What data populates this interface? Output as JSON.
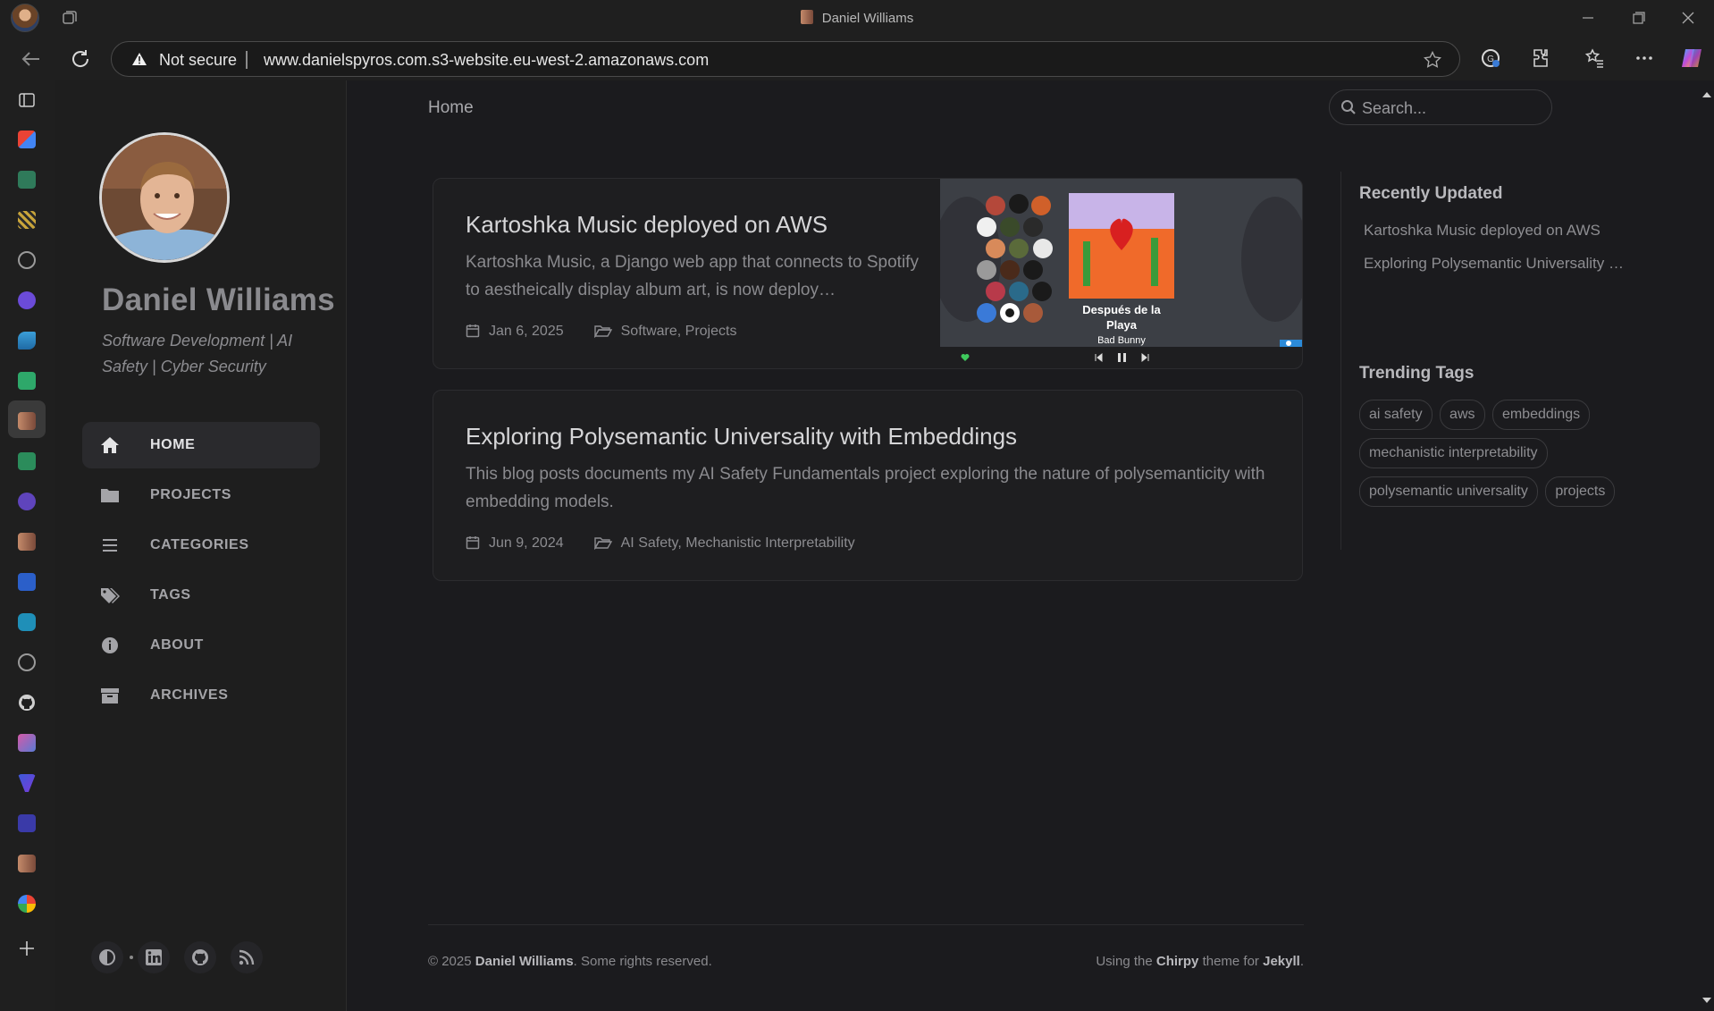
{
  "browser": {
    "window_title": "Daniel Williams",
    "security_label": "Not secure",
    "url": "www.danielspyros.com.s3-website.eu-west-2.amazonaws.com"
  },
  "blog": {
    "author_name": "Daniel Williams",
    "tagline": "Software Development | AI Safety | Cyber Security",
    "nav": [
      {
        "label": "HOME",
        "icon": "home-icon",
        "active": true
      },
      {
        "label": "PROJECTS",
        "icon": "folder-icon",
        "active": false
      },
      {
        "label": "CATEGORIES",
        "icon": "stream-icon",
        "active": false
      },
      {
        "label": "TAGS",
        "icon": "tags-icon",
        "active": false
      },
      {
        "label": "ABOUT",
        "icon": "info-icon",
        "active": false
      },
      {
        "label": "ARCHIVES",
        "icon": "archive-icon",
        "active": false
      }
    ],
    "breadcrumb": "Home",
    "search_placeholder": "Search...",
    "posts": [
      {
        "title": "Kartoshka Music deployed on AWS",
        "description": "Kartoshka Music, a Django web app that connects to Spotify to aestheically display album art, is now deploy…",
        "date": "Jan 6, 2025",
        "categories": "Software, Projects",
        "preview": {
          "album_title": "Después de la Playa",
          "artist": "Bad Bunny"
        }
      },
      {
        "title": "Exploring Polysemantic Universality with Embeddings",
        "description": "This blog posts documents my AI Safety Fundamentals project exploring the nature of polysemanticity with embedding models.",
        "date": "Jun 9, 2024",
        "categories": "AI Safety, Mechanistic Interpretability"
      }
    ],
    "recently_updated": {
      "heading": "Recently Updated",
      "items": [
        "Kartoshka Music deployed on AWS",
        "Exploring Polysemantic Universality …"
      ]
    },
    "trending_tags": {
      "heading": "Trending Tags",
      "items": [
        "ai safety",
        "aws",
        "embeddings",
        "mechanistic interpretability",
        "polysemantic universality",
        "projects"
      ]
    },
    "footer": {
      "copyright_prefix": "© 2025",
      "owner": "Daniel Williams",
      "rights": ". Some rights reserved.",
      "using": "Using the",
      "theme": "Chirpy",
      "theme_for": "theme for",
      "engine": "Jekyll",
      "period": "."
    }
  },
  "colors": {
    "accent_green": "#3ec95c",
    "bg": "#1b1b1e",
    "sidebar_bg": "#1e1e1e"
  }
}
